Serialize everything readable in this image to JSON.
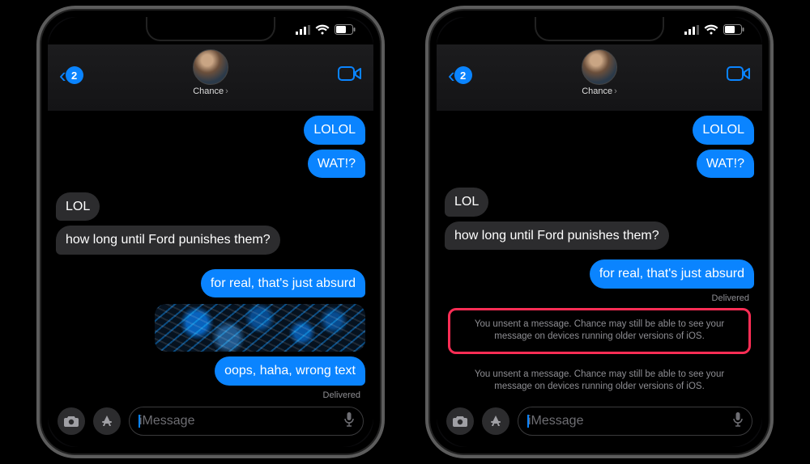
{
  "contact_name": "Chance",
  "back_badge": "2",
  "status": {
    "signal": 3,
    "wifi": true,
    "battery": 60
  },
  "left": {
    "messages": [
      {
        "side": "sent",
        "text": "LOLOL"
      },
      {
        "side": "sent",
        "text": "WAT!?"
      },
      {
        "side": "recv",
        "text": "LOL"
      },
      {
        "side": "recv",
        "text": "how long until Ford punishes them?"
      },
      {
        "side": "sent",
        "text": "for real, that's just absurd"
      }
    ],
    "unsend_visual": true,
    "post_unsend_bubble": "oops, haha, wrong text",
    "delivered_label": "Delivered",
    "input_placeholder": "iMessage"
  },
  "right": {
    "messages": [
      {
        "side": "sent",
        "text": "LOLOL"
      },
      {
        "side": "sent",
        "text": "WAT!?"
      },
      {
        "side": "recv",
        "text": "LOL"
      },
      {
        "side": "recv",
        "text": "how long until Ford punishes them?"
      },
      {
        "side": "sent",
        "text": "for real, that's just absurd"
      }
    ],
    "delivered_label": "Delivered",
    "system_notice_1": "You unsent a message. Chance may still be able to see your message on devices running older versions of iOS.",
    "system_notice_2": "You unsent a message. Chance may still be able to see your message on devices running older versions of iOS.",
    "input_placeholder": "iMessage"
  },
  "colors": {
    "accent": "#0a84ff",
    "bubble_recv": "#2c2c2e",
    "highlight": "#ff2d55"
  }
}
